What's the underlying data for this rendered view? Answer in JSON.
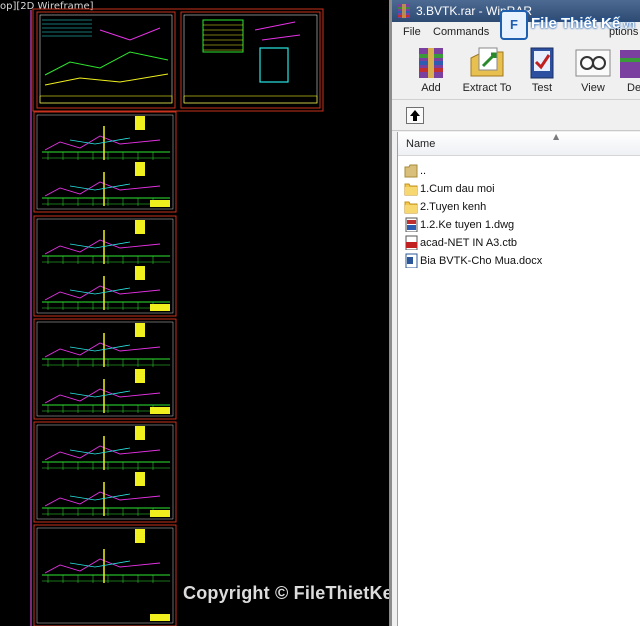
{
  "cad": {
    "viewport_label": "op][2D Wireframe]",
    "watermark": "Copyright © FileThietKe.vn",
    "colors": {
      "sheet_border": "#c8321e",
      "purple_line": "#7a2a7a",
      "green": "#2ee62e",
      "yellow": "#f0f01e",
      "magenta": "#e632e6",
      "cyan": "#28e6e6"
    }
  },
  "winrar": {
    "title": "3.BVTK.rar - WinRAR",
    "logo": {
      "badge": "F",
      "name": "File Thiết Kế",
      "domain": ".vn"
    },
    "menu": {
      "file": "File",
      "commands": "Commands",
      "options": "ptions"
    },
    "toolbar": {
      "add": "Add",
      "extract": "Extract To",
      "test": "Test",
      "view": "View",
      "delete": "De"
    },
    "list": {
      "column_name": "Name",
      "items": [
        {
          "name": "..",
          "type": "parent-folder"
        },
        {
          "name": "1.Cum dau moi",
          "type": "folder"
        },
        {
          "name": "2.Tuyen kenh",
          "type": "folder"
        },
        {
          "name": "1.2.Ke tuyen 1.dwg",
          "type": "dwg"
        },
        {
          "name": "acad-NET IN A3.ctb",
          "type": "ctb"
        },
        {
          "name": "Bia BVTK-Cho Mua.docx",
          "type": "docx"
        }
      ]
    }
  }
}
